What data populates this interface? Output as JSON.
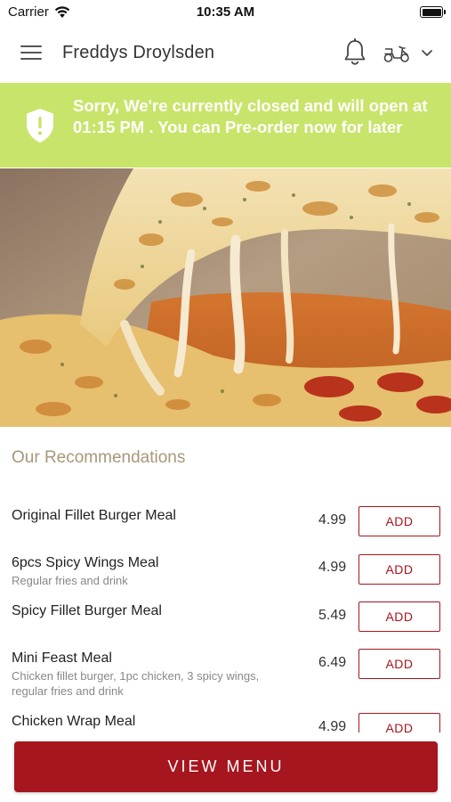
{
  "status_bar": {
    "carrier": "Carrier",
    "time": "10:35 AM"
  },
  "header": {
    "shop_name": "Freddys Droylsden",
    "icons": [
      "hamburger-menu-icon",
      "bell-icon",
      "moped-icon",
      "chevron-down-icon"
    ]
  },
  "banner": {
    "message": "Sorry, We're currently closed and will open at 01:15 PM . You can Pre-order now for later",
    "background": "#c8e46a",
    "icon": "shield-alert-icon"
  },
  "hero": {
    "image": "cheese-pizza-slice"
  },
  "recommendations": {
    "title": "Our Recommendations",
    "add_label": "ADD",
    "items": [
      {
        "name": "Original Fillet Burger Meal",
        "description": "",
        "price": "4.99"
      },
      {
        "name": "6pcs Spicy Wings Meal",
        "description": "Regular fries and drink",
        "price": "4.99"
      },
      {
        "name": "Spicy Fillet Burger Meal",
        "description": "",
        "price": "5.49"
      },
      {
        "name": "Mini Feast Meal",
        "description": "Chicken fillet burger, 1pc chicken, 3 spicy wings, regular fries and drink",
        "price": "6.49"
      },
      {
        "name": "Chicken Wrap Meal",
        "description": "",
        "price": "4.99"
      }
    ]
  },
  "footer": {
    "view_menu_label": "VIEW MENU"
  },
  "colors": {
    "accent": "#a6161e",
    "banner": "#c8e46a",
    "section_title": "#a99878"
  }
}
